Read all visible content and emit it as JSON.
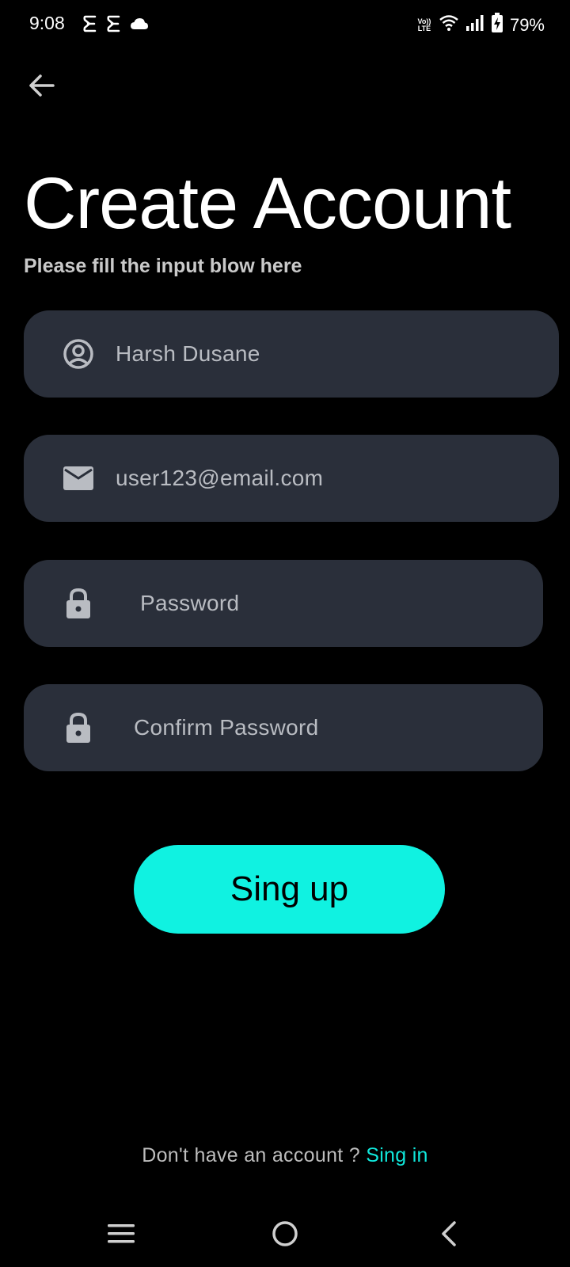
{
  "status_bar": {
    "time": "9:08",
    "battery_percent": "79%",
    "icons": [
      "notification-icon",
      "notification-icon",
      "cloud-icon",
      "volte-icon",
      "wifi-icon",
      "signal-icon",
      "battery-charging-icon"
    ],
    "volte_line1": "Vo))",
    "volte_line2": "LTE"
  },
  "header": {
    "back_icon": "arrow-left-icon"
  },
  "title": "Create Account",
  "subtitle": "Please fill the input blow here",
  "form": {
    "name_value": "Harsh Dusane",
    "email_value": "user123@email.com",
    "password_placeholder": "Password",
    "confirm_password_placeholder": "Confirm Password",
    "name_icon": "user-circle-icon",
    "email_icon": "mail-icon",
    "password_icon": "lock-icon",
    "confirm_icon": "lock-icon"
  },
  "signup_button_label": "Sing up",
  "footer": {
    "prompt": "Don't have an account ? ",
    "link": "Sing in"
  },
  "nav_bar": {
    "icons": [
      "menu-icon",
      "home-icon",
      "back-icon"
    ]
  },
  "colors": {
    "background": "#000000",
    "field_bg": "#2a2f3a",
    "accent": "#10f2e1",
    "link": "#10e8dc",
    "field_text": "#b9bcc2"
  }
}
